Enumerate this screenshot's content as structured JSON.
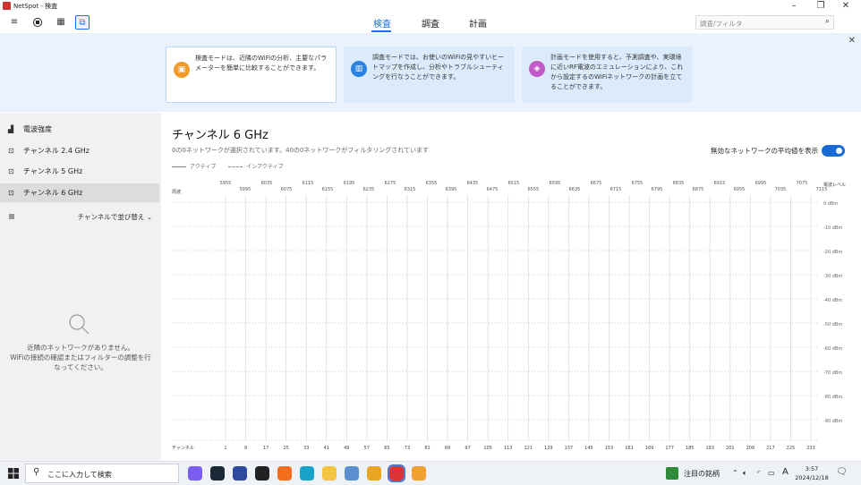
{
  "window": {
    "title": "NetSpot - 検査"
  },
  "toolbar": {
    "menu_icon": "≡",
    "modes": [
      "検査",
      "調査",
      "計画"
    ],
    "active_mode": "検査",
    "search_placeholder": "調査/フィルタ"
  },
  "banner": {
    "cards": [
      {
        "text": "検査モードは、近隣のWiFiの分析、主要なパラメーターを簡単に比較することができます。",
        "color": "#f39a2b",
        "icon": "inspect-icon"
      },
      {
        "text": "調査モードでは、お使いのWiFiの見やすいヒートマップを作成し、分析やトラブルシューティングを行なうことができます。",
        "color": "#2b82e0",
        "icon": "survey-icon"
      },
      {
        "text": "計画モードを使用すると、予測調査や、実環境に近いRF電波のエミュレーションにより、これから設定するのWiFiネットワークの計画を立てることができます。",
        "color": "#c05bc8",
        "icon": "plan-icon"
      }
    ]
  },
  "sidebar": {
    "items": [
      {
        "label": "電波強度",
        "icon": "signal-bars-icon"
      },
      {
        "label": "チャンネル 2.4 GHz",
        "icon": "channel-icon"
      },
      {
        "label": "チャンネル 5 GHz",
        "icon": "channel-icon"
      },
      {
        "label": "チャンネル 6 GHz",
        "icon": "channel-icon"
      }
    ],
    "active_index": 3,
    "sort_label": "チャンネルで並び替え ⌄",
    "empty_line1": "近隣のネットワークがありません。",
    "empty_line2": "WiFiの接続の確認またはフィルターの調整を行",
    "empty_line3": "なってください。"
  },
  "main": {
    "title": "チャンネル 6 GHz",
    "subtitle": "0の0ネットワークが選択されています。40の0ネットワークがフィルタリングされています",
    "legend_active": "アクティブ",
    "legend_inactive": "インアクティブ",
    "toggle_label": "無効なネットワークの平均値を表示",
    "toggle_on": true
  },
  "chart_data": {
    "type": "line",
    "freq_axis_label": "周波",
    "freq_top": [
      "5955",
      "6035",
      "6115",
      "6195",
      "6275",
      "6355",
      "6435",
      "6515",
      "6595",
      "6675",
      "6755",
      "6835",
      "6915",
      "6995",
      "7075"
    ],
    "freq_bottom": [
      "5995",
      "6075",
      "6155",
      "6235",
      "6315",
      "6395",
      "6475",
      "6555",
      "6635",
      "6715",
      "6795",
      "6875",
      "6955",
      "7035",
      "7115"
    ],
    "channel_axis_label": "チャンネル",
    "channels": [
      "1",
      "9",
      "17",
      "25",
      "33",
      "41",
      "49",
      "57",
      "65",
      "73",
      "81",
      "89",
      "97",
      "105",
      "113",
      "121",
      "129",
      "137",
      "145",
      "153",
      "161",
      "169",
      "177",
      "185",
      "193",
      "201",
      "209",
      "217",
      "225",
      "233"
    ],
    "level_axis_label": "電波レベル",
    "levels": [
      "0 dBm",
      "-10 dBm",
      "-20 dBm",
      "-30 dBm",
      "-40 dBm",
      "-50 dBm",
      "-60 dBm",
      "-70 dBm",
      "-80 dBm",
      "-90 dBm"
    ],
    "ylim": [
      -100,
      0
    ],
    "series": []
  },
  "taskbar": {
    "search_placeholder": "ここに入力して検索",
    "tray_news": "注目の銘柄",
    "ime": "A",
    "time": "3:57",
    "date": "2024/12/18",
    "apps": [
      {
        "icon": "copilot-icon",
        "color": "#7a5cf0"
      },
      {
        "icon": "steam-icon",
        "color": "#1b2838"
      },
      {
        "icon": "store-icon",
        "color": "#2b4aa0"
      },
      {
        "icon": "app-dark-icon",
        "color": "#222"
      },
      {
        "icon": "firefox-icon",
        "color": "#f56e1f"
      },
      {
        "icon": "edge-icon",
        "color": "#1aa3c8"
      },
      {
        "icon": "explorer-icon",
        "color": "#f4c542"
      },
      {
        "icon": "tool-icon",
        "color": "#5a8fd0"
      },
      {
        "icon": "chrome-icon",
        "color": "#e9a421"
      },
      {
        "icon": "netspot-icon",
        "color": "#d33"
      },
      {
        "icon": "app-orange-icon",
        "color": "#f0a030"
      }
    ]
  }
}
